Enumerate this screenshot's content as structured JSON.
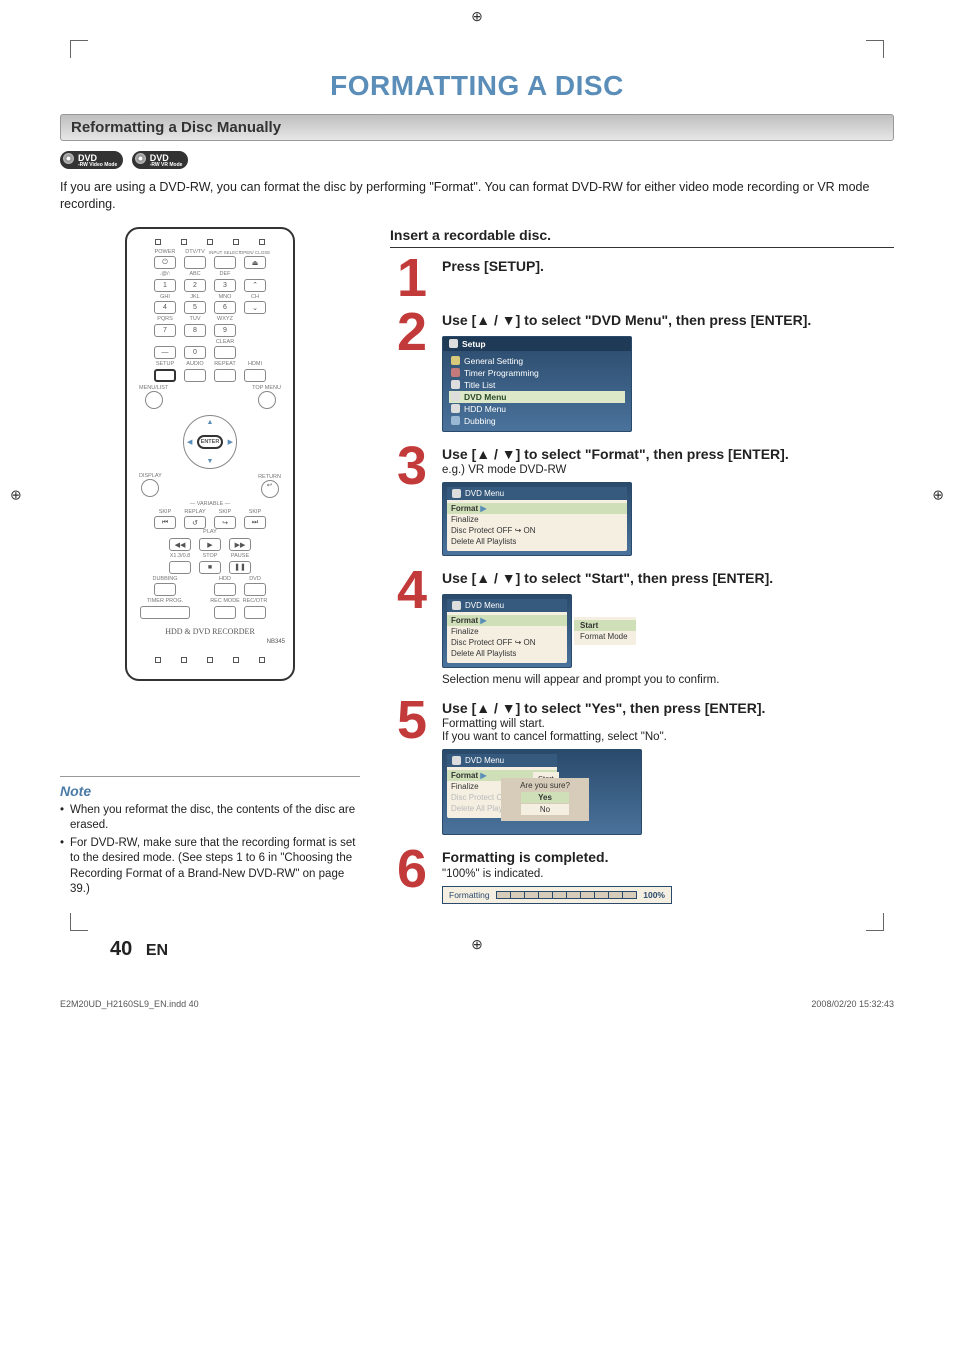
{
  "page": {
    "title": "FORMATTING A DISC",
    "section": "Reformatting a Disc Manually",
    "intro": "If you are using a DVD-RW, you can format the disc by performing \"Format\". You can format DVD-RW for either video mode recording or VR mode recording.",
    "page_number": "40",
    "page_lang": "EN",
    "footer_file": "E2M20UD_H2160SL9_EN.indd   40",
    "footer_timestamp": "2008/02/20   15:32:43"
  },
  "badges": [
    {
      "top": "DVD",
      "sub": "-RW",
      "mode": "Video Mode"
    },
    {
      "top": "DVD",
      "sub": "-RW",
      "mode": "VR Mode"
    }
  ],
  "remote": {
    "brand": "HDD & DVD RECORDER",
    "model": "NB345",
    "labels": {
      "power": "POWER",
      "dtv": "DTV/TV",
      "input": "INPUT SELECT",
      "open": "OPEN/ CLOSE",
      "abc": "ABC",
      "def": "DEF",
      "ghi": "GHI",
      "jkl": "JKL",
      "mno": "MNO",
      "pqrs": "PQRS",
      "tuv": "TUV",
      "wxyz": "WXYZ",
      "ch": "CH",
      "clear": "CLEAR",
      "setup": "SETUP",
      "audio": "AUDIO",
      "repeat": "REPEAT",
      "hdmi": "HDMI",
      "menulist": "MENU/LIST",
      "topmenu": "TOP MENU",
      "enter": "ENTER",
      "display": "DISPLAY",
      "return": "RETURN",
      "variable": "VARIABLE",
      "replay": "REPLAY",
      "skip": "SKIP",
      "skip2": "SKIP",
      "play": "PLAY",
      "x13": "X1.3/0.8",
      "stop": "STOP",
      "pause": "PAUSE",
      "dubbing": "DUBBING",
      "hdd": "HDD",
      "dvd": "DVD",
      "timer": "TIMER PROG.",
      "recmode": "REC MODE",
      "recotr": "REC/OTR",
      "sym": ".@/:"
    },
    "keys": {
      "k1": "1",
      "k2": "2",
      "k3": "3",
      "k4": "4",
      "k5": "5",
      "k6": "6",
      "k7": "7",
      "k8": "8",
      "k9": "9",
      "k0": "0",
      "dash": "—"
    }
  },
  "note": {
    "title": "Note",
    "items": [
      "When you reformat the disc, the contents of the disc are erased.",
      "For DVD-RW, make sure that the recording format is set to the desired mode. (See steps 1 to 6 in \"Choosing the Recording Format of a Brand-New DVD-RW\" on page 39.)"
    ]
  },
  "insert_header": "Insert a recordable disc.",
  "steps": {
    "s1": {
      "num": "1",
      "title": "Press [SETUP]."
    },
    "s2": {
      "num": "2",
      "title": "Use [▲ / ▼] to select \"DVD Menu\", then press [ENTER].",
      "menu_title": "Setup",
      "items": [
        "General Setting",
        "Timer Programming",
        "Title List",
        "DVD Menu",
        "HDD Menu",
        "Dubbing"
      ],
      "selected": "DVD Menu"
    },
    "s3": {
      "num": "3",
      "title": "Use [▲ / ▼] to select \"Format\", then press [ENTER].",
      "sub": "e.g.) VR mode DVD-RW",
      "menu_title": "DVD Menu",
      "items": [
        "Format",
        "Finalize",
        "Disc Protect OFF ↪ ON",
        "Delete All Playlists"
      ],
      "selected": "Format"
    },
    "s4": {
      "num": "4",
      "title": "Use [▲ / ▼] to select \"Start\", then press [ENTER].",
      "menu_title": "DVD Menu",
      "items": [
        "Format",
        "Finalize",
        "Disc Protect OFF ↪ ON",
        "Delete All Playlists"
      ],
      "selected": "Format",
      "panel": [
        "Start",
        "Format Mode"
      ],
      "panel_selected": "Start",
      "after": "Selection menu will appear and prompt you to confirm."
    },
    "s5": {
      "num": "5",
      "title": "Use [▲ / ▼] to select \"Yes\", then press [ENTER].",
      "sub1": "Formatting will start.",
      "sub2": "If you want to cancel formatting, select \"No\".",
      "menu_title": "DVD Menu",
      "items": [
        "Format",
        "Finalize",
        "Disc Protect OFF",
        "Delete All Playl"
      ],
      "selected": "Format",
      "start_box": [
        "Start",
        "de"
      ],
      "confirm_q": "Are you sure?",
      "confirm_opts": [
        "Yes",
        "No"
      ],
      "confirm_selected": "Yes"
    },
    "s6": {
      "num": "6",
      "title": "Formatting is completed.",
      "sub": "\"100%\" is indicated.",
      "bar_label": "Formatting",
      "bar_pct": "100%"
    }
  }
}
